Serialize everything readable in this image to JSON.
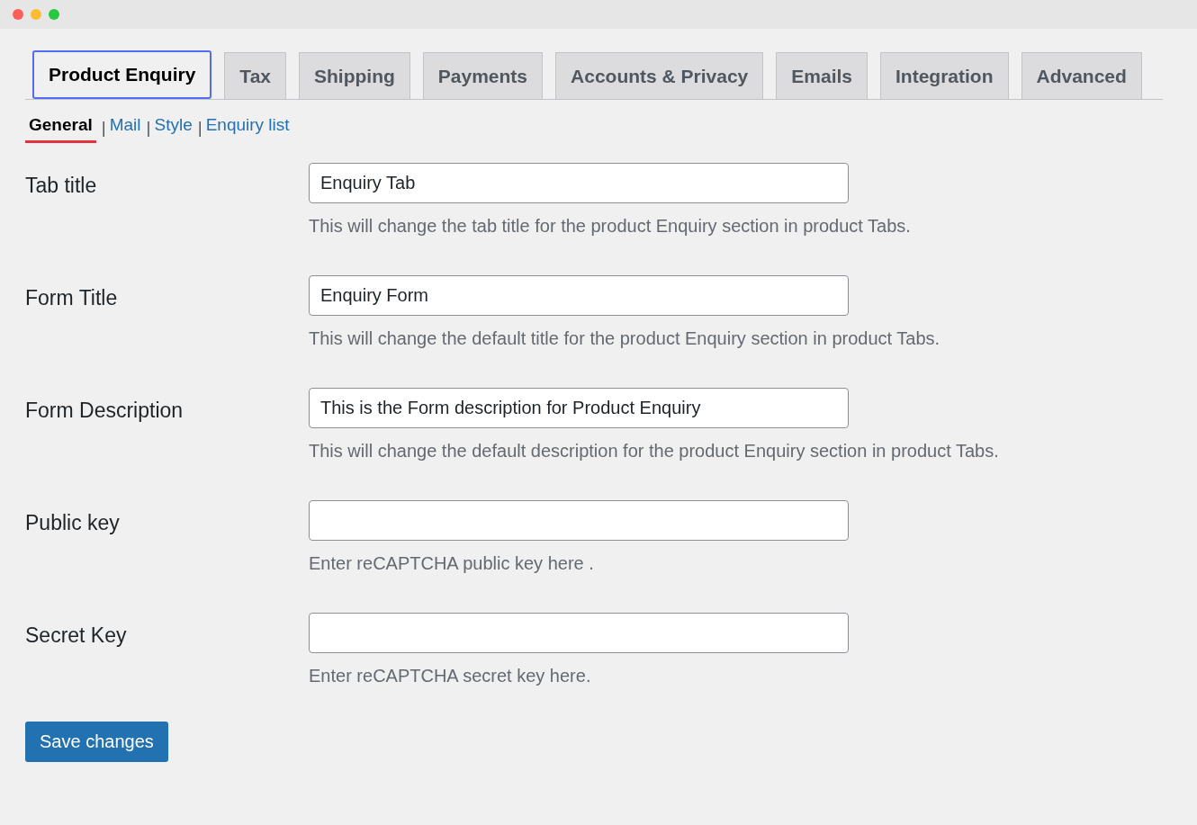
{
  "tabs": [
    {
      "label": "Product Enquiry",
      "selected": true
    },
    {
      "label": "Tax",
      "selected": false
    },
    {
      "label": "Shipping",
      "selected": false
    },
    {
      "label": "Payments",
      "selected": false
    },
    {
      "label": "Accounts & Privacy",
      "selected": false
    },
    {
      "label": "Emails",
      "selected": false
    },
    {
      "label": "Integration",
      "selected": false
    },
    {
      "label": "Advanced",
      "selected": false
    }
  ],
  "subtabs": {
    "separator": "|",
    "items": [
      {
        "label": "General",
        "selected": true
      },
      {
        "label": "Mail",
        "selected": false
      },
      {
        "label": "Style",
        "selected": false
      },
      {
        "label": "Enquiry list",
        "selected": false
      }
    ]
  },
  "fields": [
    {
      "label": "Tab title",
      "value": "Enquiry Tab",
      "description": "This will change the tab title for the product Enquiry section in product Tabs."
    },
    {
      "label": "Form Title",
      "value": "Enquiry Form",
      "description": "This will change the default title for the product Enquiry section in product Tabs."
    },
    {
      "label": "Form Description",
      "value": "This is the Form description for Product Enquiry",
      "description": "This will change the default description for the product Enquiry section in product Tabs."
    },
    {
      "label": "Public key",
      "description": "Enter reCAPTCHA public key here ."
    },
    {
      "label": "Secret Key",
      "description": "Enter reCAPTCHA secret key here."
    }
  ],
  "save_button": "Save changes"
}
